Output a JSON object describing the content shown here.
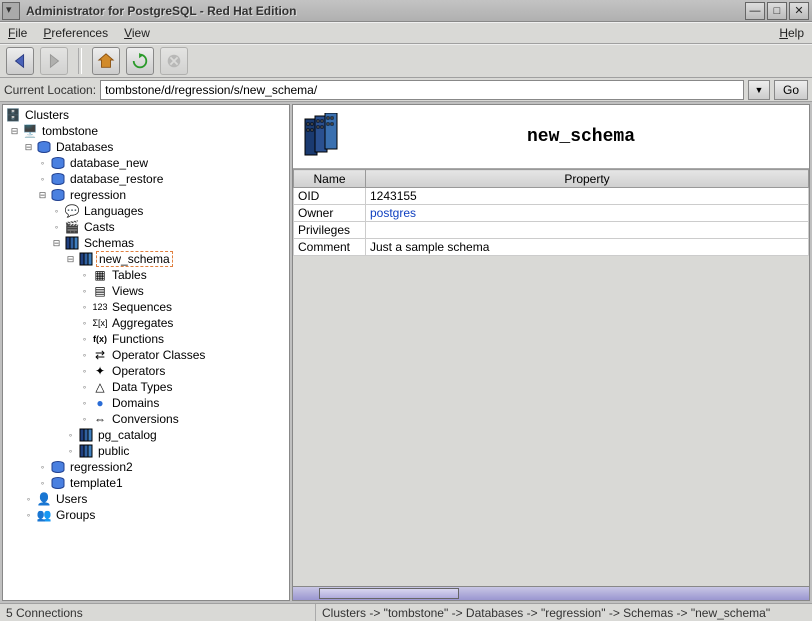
{
  "window": {
    "title": "Administrator for PostgreSQL - Red Hat Edition"
  },
  "menu": {
    "file": "File",
    "preferences": "Preferences",
    "view": "View",
    "help": "Help"
  },
  "location": {
    "label": "Current Location:",
    "value": "tombstone/d/regression/s/new_schema/",
    "go": "Go"
  },
  "tree": {
    "root": "Clusters",
    "cluster": "tombstone",
    "databases_label": "Databases",
    "databases": {
      "database_new": "database_new",
      "database_restore": "database_restore",
      "regression": "regression",
      "regression2": "regression2",
      "template1": "template1"
    },
    "regression_children": {
      "languages": "Languages",
      "casts": "Casts",
      "schemas": "Schemas"
    },
    "schemas": {
      "new_schema": "new_schema",
      "pg_catalog": "pg_catalog",
      "public": "public"
    },
    "schema_children": {
      "tables": "Tables",
      "views": "Views",
      "sequences": "Sequences",
      "aggregates": "Aggregates",
      "functions": "Functions",
      "operator_classes": "Operator Classes",
      "operators": "Operators",
      "data_types": "Data Types",
      "domains": "Domains",
      "conversions": "Conversions"
    },
    "users": "Users",
    "groups": "Groups"
  },
  "detail": {
    "title": "new_schema",
    "headers": {
      "name": "Name",
      "property": "Property"
    },
    "rows": {
      "oid_k": "OID",
      "oid_v": "1243155",
      "owner_k": "Owner",
      "owner_v": "postgres",
      "priv_k": "Privileges",
      "priv_v": "",
      "comment_k": "Comment",
      "comment_v": "Just a sample schema"
    }
  },
  "status": {
    "connections": "5 Connections",
    "breadcrumb": "Clusters -> \"tombstone\" -> Databases -> \"regression\" -> Schemas -> \"new_schema\""
  }
}
